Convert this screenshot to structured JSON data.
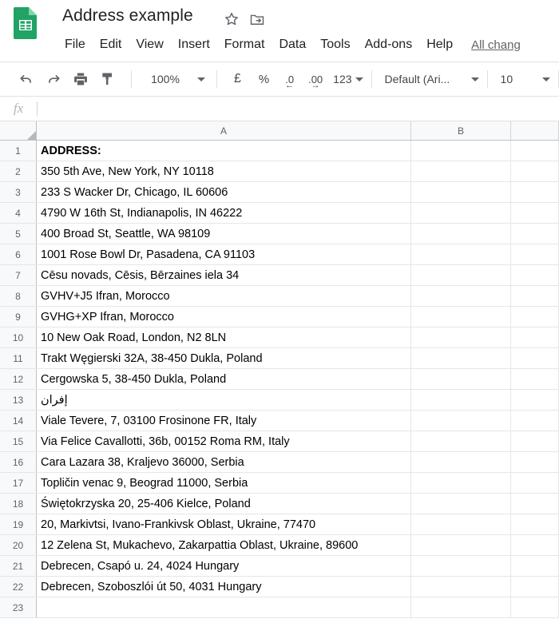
{
  "app": {
    "logo_icon": "google-sheets-logo",
    "doc_title": "Address example",
    "star_icon": "star-icon",
    "move_icon": "move-to-folder-icon",
    "save_status": "All chang"
  },
  "menubar": {
    "items": [
      {
        "label": "File"
      },
      {
        "label": "Edit"
      },
      {
        "label": "View"
      },
      {
        "label": "Insert"
      },
      {
        "label": "Format"
      },
      {
        "label": "Data"
      },
      {
        "label": "Tools"
      },
      {
        "label": "Add-ons"
      },
      {
        "label": "Help"
      }
    ]
  },
  "toolbar": {
    "undo_icon": "undo-icon",
    "redo_icon": "redo-icon",
    "print_icon": "print-icon",
    "paint_format_icon": "paint-format-icon",
    "zoom_value": "100%",
    "currency_label": "£",
    "percent_label": "%",
    "decrease_decimal_label": ".0",
    "decrease_decimal_arrow": "←",
    "increase_decimal_label": ".00",
    "increase_decimal_arrow": "→",
    "number_format_label": "123",
    "font_family_value": "Default (Ari...",
    "font_size_value": "10"
  },
  "formula_bar": {
    "fx_label": "fx",
    "value": ""
  },
  "grid": {
    "columns": [
      {
        "label": "A"
      },
      {
        "label": "B"
      },
      {
        "label": ""
      }
    ],
    "rows": [
      {
        "num": "1",
        "a": "ADDRESS:",
        "bold": true,
        "rtl": false
      },
      {
        "num": "2",
        "a": "350 5th Ave, New York, NY 10118",
        "bold": false,
        "rtl": false
      },
      {
        "num": "3",
        "a": "233 S Wacker Dr, Chicago, IL 60606",
        "bold": false,
        "rtl": false
      },
      {
        "num": "4",
        "a": "4790 W 16th St, Indianapolis, IN 46222",
        "bold": false,
        "rtl": false
      },
      {
        "num": "5",
        "a": "400 Broad St, Seattle, WA 98109",
        "bold": false,
        "rtl": false
      },
      {
        "num": "6",
        "a": "1001 Rose Bowl Dr, Pasadena, CA 91103",
        "bold": false,
        "rtl": false
      },
      {
        "num": "7",
        "a": "Cēsu novads, Cēsis, Bērzaines iela 34",
        "bold": false,
        "rtl": false
      },
      {
        "num": "8",
        "a": "GVHV+J5 Ifran, Morocco",
        "bold": false,
        "rtl": false
      },
      {
        "num": "9",
        "a": "GVHG+XP Ifran, Morocco",
        "bold": false,
        "rtl": false
      },
      {
        "num": "10",
        "a": "10 New Oak Road, London, N2 8LN",
        "bold": false,
        "rtl": false
      },
      {
        "num": "11",
        "a": "Trakt Węgierski 32A, 38-450 Dukla, Poland",
        "bold": false,
        "rtl": false
      },
      {
        "num": "12",
        "a": "Cergowska 5, 38-450 Dukla, Poland",
        "bold": false,
        "rtl": false
      },
      {
        "num": "13",
        "a": "إفران",
        "bold": false,
        "rtl": true
      },
      {
        "num": "14",
        "a": "Viale Tevere, 7, 03100 Frosinone FR, Italy",
        "bold": false,
        "rtl": false
      },
      {
        "num": "15",
        "a": "Via Felice Cavallotti, 36b, 00152 Roma RM, Italy",
        "bold": false,
        "rtl": false
      },
      {
        "num": "16",
        "a": "Cara Lazara 38, Kraljevo 36000, Serbia",
        "bold": false,
        "rtl": false
      },
      {
        "num": "17",
        "a": "Topličin venac 9, Beograd 11000, Serbia",
        "bold": false,
        "rtl": false
      },
      {
        "num": "18",
        "a": "Świętokrzyska 20, 25-406 Kielce, Poland",
        "bold": false,
        "rtl": false
      },
      {
        "num": "19",
        "a": "20, Markivtsi, Ivano-Frankivsk Oblast, Ukraine, 77470",
        "bold": false,
        "rtl": false
      },
      {
        "num": "20",
        "a": "12 Zelena St, Mukachevo, Zakarpattia Oblast, Ukraine, 89600",
        "bold": false,
        "rtl": false
      },
      {
        "num": "21",
        "a": "Debrecen, Csapó u. 24, 4024 Hungary",
        "bold": false,
        "rtl": false
      },
      {
        "num": "22",
        "a": "Debrecen, Szoboszlói út 50, 4031 Hungary",
        "bold": false,
        "rtl": false
      },
      {
        "num": "23",
        "a": "",
        "bold": false,
        "rtl": false
      }
    ]
  },
  "colors": {
    "brand_green": "#21a366",
    "header_bg": "#f8f9fa",
    "grid_line": "#e4e6e8",
    "text": "#222222"
  }
}
